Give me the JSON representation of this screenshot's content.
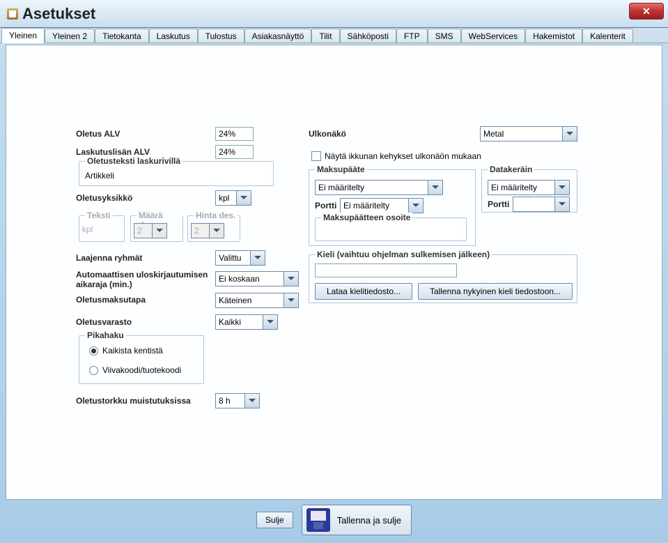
{
  "window": {
    "title": "Asetukset",
    "close_x": "✕"
  },
  "tabs": [
    "Yleinen",
    "Yleinen 2",
    "Tietokanta",
    "Laskutus",
    "Tulostus",
    "Asiakasnäyttö",
    "Tilit",
    "Sähköposti",
    "FTP",
    "SMS",
    "WebServices",
    "Hakemistot",
    "Kalenterit"
  ],
  "left": {
    "oletus_alv_label": "Oletus ALV",
    "oletus_alv_value": "24%",
    "laskutuslisan_alv_label": "Laskutuslisän ALV",
    "laskutuslisan_alv_value": "24%",
    "oletusteksti_legend": "Oletusteksti laskurivillä",
    "oletusteksti_value": "Artikkeli",
    "oletusyksikko_label": "Oletusyksikkö",
    "oletusyksikko_value": "kpl",
    "teksti_legend": "Teksti",
    "teksti_value": "kpl",
    "maara_legend": "Määrä de...",
    "maara_value": "2",
    "hinta_legend": "Hinta des.",
    "hinta_value": "2",
    "laajenna_label": "Laajenna ryhmät",
    "laajenna_value": "Valittu",
    "aikaraja_label1": "Automaattisen uloskirjautumisen",
    "aikaraja_label2": "aikaraja (min.)",
    "aikaraja_value": "Ei koskaan",
    "maksutapa_label": "Oletusmaksutapa",
    "maksutapa_value": "Käteinen",
    "varasto_label": "Oletusvarasto",
    "varasto_value": "Kaikki",
    "pikahaku_legend": "Pikahaku",
    "pikahaku_opt1": "Kaikista kentistä",
    "pikahaku_opt2": "Viivakoodi/tuotekoodi",
    "torkku_label": "Oletustorkku muistutuksissa",
    "torkku_value": "8 h"
  },
  "right": {
    "ulkonako_label": "Ulkonäkö",
    "ulkonako_value": "Metal",
    "nayta_ikkunan_label": "Näytä ikkunan kehykset ulkonäön mukaan",
    "maksupaate_legend": "Maksupääte",
    "maksupaate_value": "Ei määritelty",
    "maksu_portti_label": "Portti",
    "maksu_portti_value": "Ei määritelty",
    "maksu_osoite_legend": "Maksupäätteen osoite",
    "maksu_osoite_value": "",
    "datakerain_legend": "Datakeräin",
    "datakerain_value": "Ei määritelty",
    "data_portti_label": "Portti",
    "data_portti_value": "",
    "kieli_legend": "Kieli (vaihtuu ohjelman sulkemisen jälkeen)",
    "kieli_value": "",
    "lataa_label": "Lataa kielitiedosto...",
    "tallenna_label": "Tallenna nykyinen kieli tiedostoon..."
  },
  "footer": {
    "sulje": "Sulje",
    "tallenna_sulje": "Tallenna ja sulje"
  }
}
